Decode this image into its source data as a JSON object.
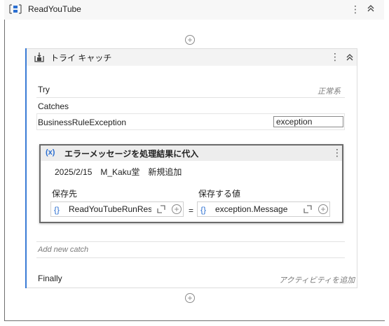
{
  "sequence": {
    "title": "ReadYouTube"
  },
  "try_catch": {
    "title": "トライ キャッチ",
    "try_label": "Try",
    "try_status": "正常系",
    "catches_label": "Catches",
    "exception_type": "BusinessRuleException",
    "exception_var": "exception",
    "add_catch": "Add new catch",
    "finally_label": "Finally",
    "finally_placeholder": "アクティビティを追加"
  },
  "assign": {
    "title": "エラーメッセージを処理結果に代入",
    "annotation": "2025/2/15　M_Kaku堂　新規追加",
    "to_label": "保存先",
    "value_label": "保存する値",
    "to_value": "ReadYouTubeRunResu",
    "value_value": "exception.Message",
    "equals": "="
  },
  "icons": {
    "sequence": "sequence-icon",
    "try_catch": "try-catch-icon",
    "assign": "assign-icon",
    "more": "more-vertical-icon",
    "collapse": "collapse-icon",
    "add": "add-circle-icon",
    "expand": "expand-icon"
  },
  "colors": {
    "accent": "#3a7bd5",
    "variable_brace": "#2b6fd1"
  }
}
